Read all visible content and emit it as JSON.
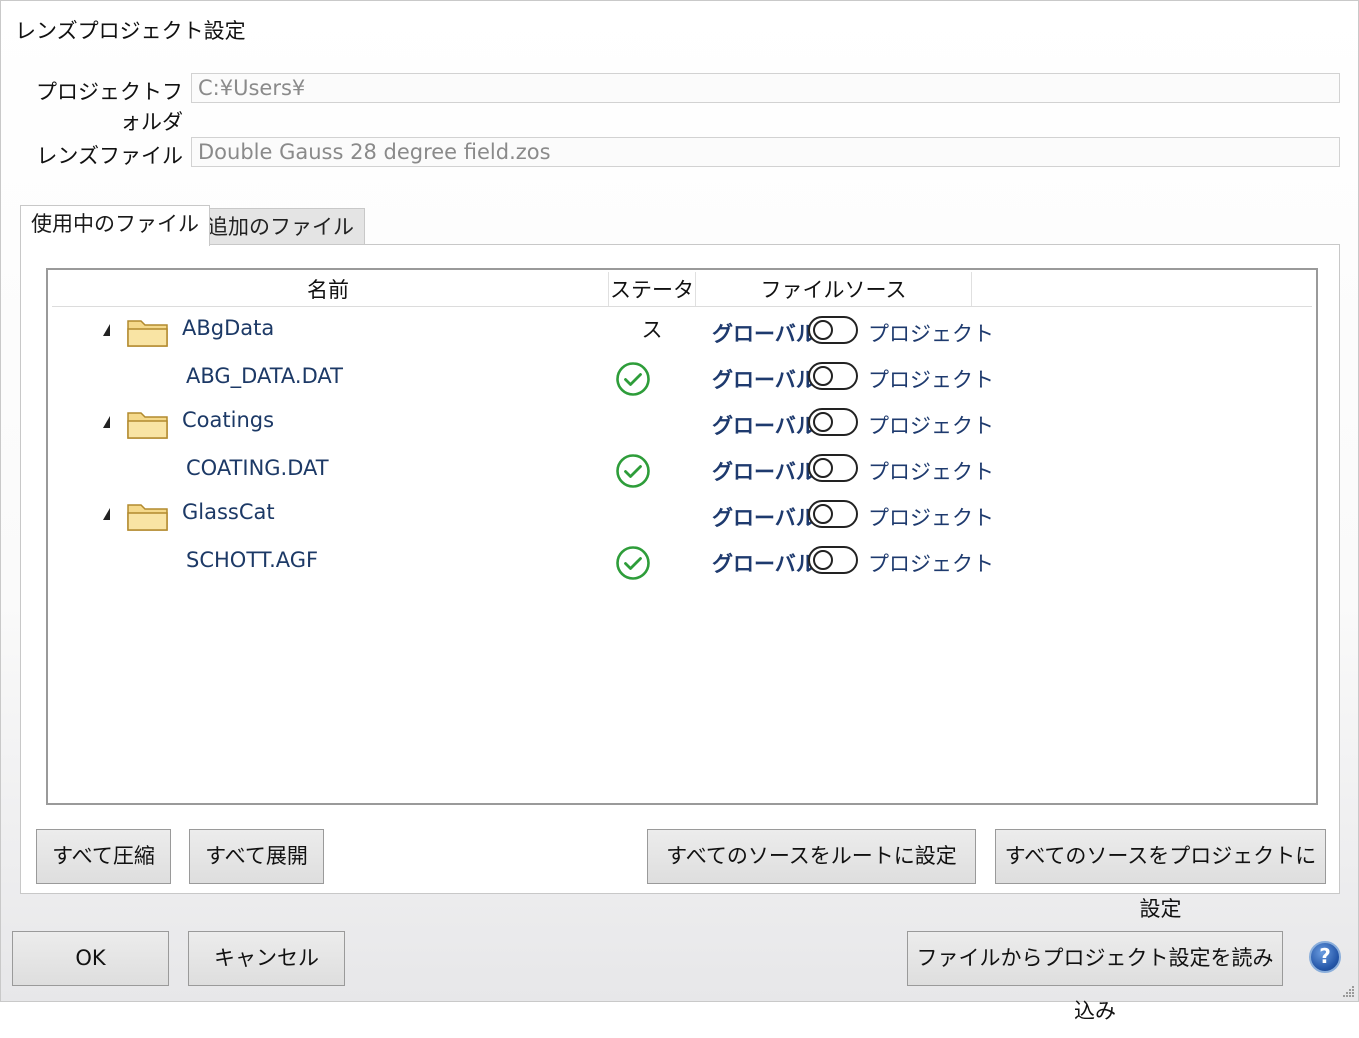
{
  "window": {
    "title": "レンズプロジェクト設定"
  },
  "fields": {
    "project_folder_label": "プロジェクトフォルダ",
    "project_folder_value": "C:¥Users¥",
    "lens_file_label": "レンズファイル",
    "lens_file_value": "Double Gauss 28 degree field.zos"
  },
  "tabs": [
    {
      "label": "使用中のファイル",
      "active": true
    },
    {
      "label": "追加のファイル",
      "active": false
    }
  ],
  "tree": {
    "columns": {
      "name": "名前",
      "status": "ステータス",
      "source": "ファイルソース"
    },
    "rows": [
      {
        "type": "folder",
        "name": "ABgData",
        "expanded": true,
        "source_global": "グローバル",
        "source_project": "プロジェクト",
        "toggle_on": false
      },
      {
        "type": "file",
        "name": "ABG_DATA.DAT",
        "status_icon": "check-circle-icon",
        "source_global": "グローバル",
        "source_project": "プロジェクト",
        "toggle_on": false
      },
      {
        "type": "folder",
        "name": "Coatings",
        "expanded": true,
        "source_global": "グローバル",
        "source_project": "プロジェクト",
        "toggle_on": false
      },
      {
        "type": "file",
        "name": "COATING.DAT",
        "status_icon": "check-circle-icon",
        "source_global": "グローバル",
        "source_project": "プロジェクト",
        "toggle_on": false
      },
      {
        "type": "folder",
        "name": "GlassCat",
        "expanded": true,
        "source_global": "グローバル",
        "source_project": "プロジェクト",
        "toggle_on": false
      },
      {
        "type": "file",
        "name": "SCHOTT.AGF",
        "status_icon": "check-circle-icon",
        "source_global": "グローバル",
        "source_project": "プロジェクト",
        "toggle_on": false
      }
    ]
  },
  "panel_buttons": {
    "collapse_all": "すべて圧縮",
    "expand_all": "すべて展開",
    "set_all_root": "すべてのソースをルートに設定",
    "set_all_project": "すべてのソースをプロジェクトに設定"
  },
  "dialog_buttons": {
    "ok": "OK",
    "cancel": "キャンセル",
    "load_from_file": "ファイルからプロジェクト設定を読み込み",
    "help": "?"
  },
  "colors": {
    "accent_text": "#1e3a6e",
    "status_ok": "#2e9d3a",
    "folder_fill": "#f5d98b",
    "help_icon": "#2456a8"
  }
}
